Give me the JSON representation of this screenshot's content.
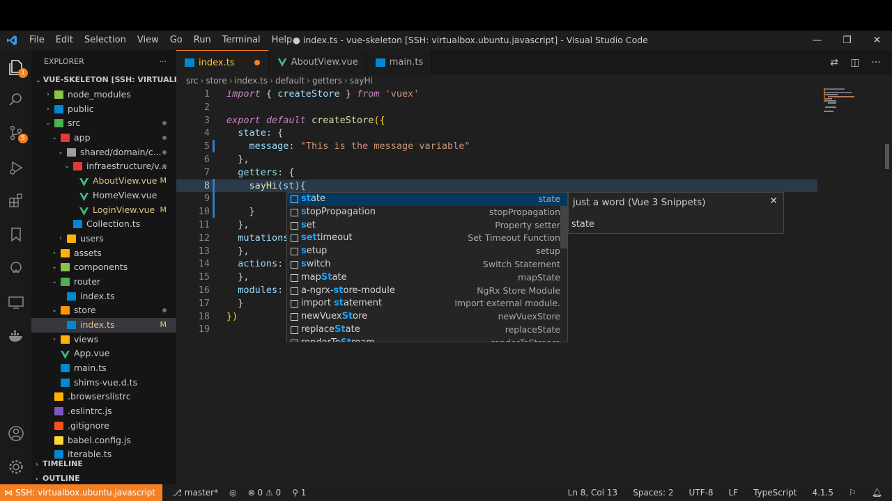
{
  "window": {
    "title": "● index.ts - vue-skeleton [SSH: virtualbox.ubuntu.javascript] - Visual Studio Code",
    "menu": [
      "File",
      "Edit",
      "Selection",
      "View",
      "Go",
      "Run",
      "Terminal",
      "Help"
    ],
    "controls": {
      "minimize": "—",
      "restore": "❐",
      "close": "✕"
    }
  },
  "activity_bar": {
    "items": [
      "explorer-icon",
      "search-icon",
      "source-control-icon",
      "run-debug-icon",
      "extensions-icon",
      "bookmarks-icon",
      "remote-explorer-icon",
      "remote-window-icon",
      "docker-icon",
      "accounts-icon",
      "settings-gear-icon"
    ],
    "explorer_badge": "1",
    "scm_badge": "5"
  },
  "explorer": {
    "header": "EXPLORER",
    "more": "···",
    "root": "VUE-SKELETON [SSH: VIRTUALBOX.UBUNTU.JAVASCRIPT]",
    "tree": [
      {
        "name": "node_modules",
        "indent": 1,
        "type": "folder",
        "chev": "›",
        "color": "#8bc34a",
        "status": ""
      },
      {
        "name": "public",
        "indent": 1,
        "type": "folder",
        "chev": "›",
        "color": "#0288d1",
        "status": ""
      },
      {
        "name": "src",
        "indent": 1,
        "type": "folder",
        "chev": "⌄",
        "color": "#4caf50",
        "status": "dot"
      },
      {
        "name": "app",
        "indent": 2,
        "type": "folder",
        "chev": "⌄",
        "color": "#e53935",
        "status": "dot"
      },
      {
        "name": "shared/domain/c...",
        "indent": 3,
        "type": "folder",
        "chev": "⌄",
        "color": "#9e9e9e",
        "status": "dot"
      },
      {
        "name": "infraestructure/v...",
        "indent": 4,
        "type": "folder",
        "chev": "⌄",
        "color": "#e53935",
        "status": "dot"
      },
      {
        "name": "AboutView.vue",
        "indent": 5,
        "type": "vue",
        "chev": "",
        "color": "#41b883",
        "status": "M"
      },
      {
        "name": "HomeView.vue",
        "indent": 5,
        "type": "vue",
        "chev": "",
        "color": "#41b883",
        "status": ""
      },
      {
        "name": "LoginView.vue",
        "indent": 5,
        "type": "vue",
        "chev": "",
        "color": "#41b883",
        "status": "M"
      },
      {
        "name": "Collection.ts",
        "indent": 4,
        "type": "ts",
        "chev": "",
        "color": "#0288d1",
        "status": ""
      },
      {
        "name": "users",
        "indent": 3,
        "type": "folder",
        "chev": "›",
        "color": "#ffb300",
        "status": ""
      },
      {
        "name": "assets",
        "indent": 2,
        "type": "folder",
        "chev": "›",
        "color": "#ffb300",
        "status": ""
      },
      {
        "name": "components",
        "indent": 2,
        "type": "folder",
        "chev": "⌄",
        "color": "#8bc34a",
        "status": ""
      },
      {
        "name": "router",
        "indent": 2,
        "type": "folder",
        "chev": "⌄",
        "color": "#4caf50",
        "status": ""
      },
      {
        "name": "index.ts",
        "indent": 3,
        "type": "ts",
        "chev": "",
        "color": "#0288d1",
        "status": ""
      },
      {
        "name": "store",
        "indent": 2,
        "type": "folder",
        "chev": "⌄",
        "color": "#ff9800",
        "status": "dot"
      },
      {
        "name": "index.ts",
        "indent": 3,
        "type": "ts",
        "chev": "",
        "color": "#0288d1",
        "status": "M",
        "selected": true
      },
      {
        "name": "views",
        "indent": 2,
        "type": "folder",
        "chev": "›",
        "color": "#ffb300",
        "status": ""
      },
      {
        "name": "App.vue",
        "indent": 2,
        "type": "vue",
        "chev": "",
        "color": "#41b883",
        "status": ""
      },
      {
        "name": "main.ts",
        "indent": 2,
        "type": "ts",
        "chev": "",
        "color": "#0288d1",
        "status": ""
      },
      {
        "name": "shims-vue.d.ts",
        "indent": 2,
        "type": "ts",
        "chev": "",
        "color": "#0288d1",
        "status": ""
      },
      {
        "name": ".browserslistrc",
        "indent": 1,
        "type": "file",
        "chev": "",
        "color": "#ffb300",
        "status": ""
      },
      {
        "name": ".eslintrc.js",
        "indent": 1,
        "type": "file",
        "chev": "",
        "color": "#7e57c2",
        "status": ""
      },
      {
        "name": ".gitignore",
        "indent": 1,
        "type": "file",
        "chev": "",
        "color": "#f4511e",
        "status": ""
      },
      {
        "name": "babel.config.js",
        "indent": 1,
        "type": "file",
        "chev": "",
        "color": "#fdd835",
        "status": ""
      },
      {
        "name": "iterable.ts",
        "indent": 1,
        "type": "ts",
        "chev": "",
        "color": "#0288d1",
        "status": ""
      }
    ],
    "sections": [
      "TIMELINE",
      "OUTLINE"
    ]
  },
  "tabs": [
    {
      "label": "index.ts",
      "active": true,
      "modified": true,
      "icon_color": "#0288d1"
    },
    {
      "label": "AboutView.vue",
      "active": false,
      "modified": false,
      "icon_color": "#41b883"
    },
    {
      "label": "main.ts",
      "active": false,
      "modified": false,
      "icon_color": "#0288d1"
    }
  ],
  "breadcrumb": [
    "src",
    "store",
    "index.ts",
    "default",
    "getters",
    "sayHi"
  ],
  "code": [
    {
      "n": "1",
      "html": "<span class='kw'>import</span><span class='punc'> { </span><span class='prop'>createStore</span><span class='punc'> } </span><span class='kw'>from</span><span class='punc'> </span><span class='str'>'vuex'</span>"
    },
    {
      "n": "2",
      "html": ""
    },
    {
      "n": "3",
      "html": "<span class='kw'>export default</span><span class='punc'> </span><span class='fn'>createStore</span><span class='br'>({</span>"
    },
    {
      "n": "4",
      "html": "<span class='punc'>  </span><span class='prop'>state</span><span class='punc'>: {</span>"
    },
    {
      "n": "5",
      "html": "<span class='punc'>    </span><span class='prop'>message</span><span class='punc'>: </span><span class='str'>\"This is the message variable\"</span>"
    },
    {
      "n": "6",
      "html": "<span class='punc'>  },</span>"
    },
    {
      "n": "7",
      "html": "<span class='punc'>  </span><span class='prop'>getters</span><span class='punc'>: {</span>"
    },
    {
      "n": "8",
      "html": "<span class='punc'>    </span><span class='fn'>sayHi</span><span class='punc'>(</span><span class='prop'>st</span><span class='punc'>){</span>",
      "current": true
    },
    {
      "n": "9",
      "html": ""
    },
    {
      "n": "10",
      "html": "<span class='punc'>    }</span>"
    },
    {
      "n": "11",
      "html": "<span class='punc'>  },</span>"
    },
    {
      "n": "12",
      "html": "<span class='punc'>  </span><span class='prop'>mutations</span><span class='punc'>: {</span>"
    },
    {
      "n": "13",
      "html": "<span class='punc'>  },</span>"
    },
    {
      "n": "14",
      "html": "<span class='punc'>  </span><span class='prop'>actions</span><span class='punc'>: {</span>"
    },
    {
      "n": "15",
      "html": "<span class='punc'>  },</span>"
    },
    {
      "n": "16",
      "html": "<span class='punc'>  </span><span class='prop'>modules</span><span class='punc'>: {</span>"
    },
    {
      "n": "17",
      "html": "<span class='punc'>  }</span>"
    },
    {
      "n": "18",
      "html": "<span class='br'>})</span>"
    },
    {
      "n": "19",
      "html": ""
    }
  ],
  "suggestions": [
    {
      "label": "state",
      "hl": [
        0,
        2
      ],
      "detail": "state",
      "focused": true
    },
    {
      "label": "stopPropagation",
      "hl": [
        0,
        1
      ],
      "detail": "stopPropagation"
    },
    {
      "label": "set",
      "hl": [
        0,
        1
      ],
      "detail": "Property setter"
    },
    {
      "label": "settimeout",
      "hl": [
        0,
        3
      ],
      "detail": "Set Timeout Function"
    },
    {
      "label": "setup",
      "hl": [
        0,
        1
      ],
      "detail": "setup"
    },
    {
      "label": "switch",
      "hl": [
        0,
        1
      ],
      "detail": "Switch Statement"
    },
    {
      "label": "mapState",
      "hl": [
        3,
        5
      ],
      "detail": "mapState"
    },
    {
      "label": "a-ngrx-store-module",
      "hl": [
        7,
        9
      ],
      "detail": "NgRx Store Module"
    },
    {
      "label": "import statement",
      "hl": [
        7,
        9
      ],
      "detail": "Import external module."
    },
    {
      "label": "newVuexStore",
      "hl": [
        7,
        9
      ],
      "detail": "newVuexStore"
    },
    {
      "label": "replaceState",
      "hl": [
        7,
        9
      ],
      "detail": "replaceState"
    },
    {
      "label": "renderToStream",
      "hl": [
        8,
        10
      ],
      "detail": "renderToStream"
    }
  ],
  "suggest_details": {
    "title": "just a word (Vue 3 Snippets)",
    "body": "state",
    "close": "✕"
  },
  "statusbar": {
    "remote": "SSH: virtualbox.ubuntu.javascript",
    "branch": "master*",
    "sync": "◎",
    "problems": "⊗ 0 ⚠ 0",
    "ports": "1",
    "position": "Ln 8, Col 13",
    "spaces": "Spaces: 2",
    "encoding": "UTF-8",
    "eol": "LF",
    "language": "TypeScript",
    "version": "4.1.5"
  },
  "colors": {
    "accent": "#f48024",
    "editor_bg": "#1f1f1f",
    "tab_active_text": "#f3c53f"
  }
}
